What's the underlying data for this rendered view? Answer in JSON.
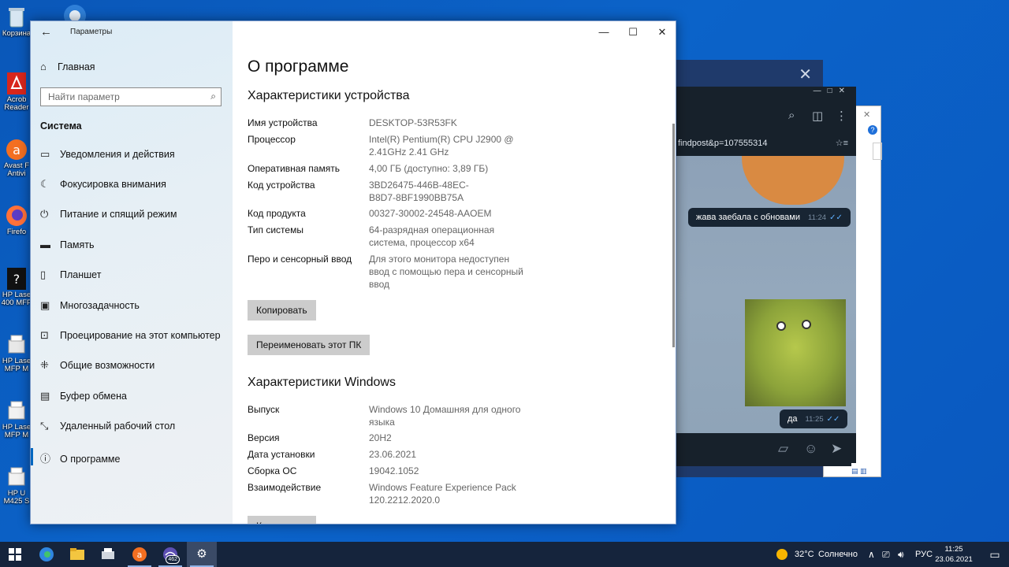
{
  "desktop": {
    "icons": [
      {
        "label": "Корзина",
        "icon": "recycle-bin-icon"
      },
      {
        "label": "Acrob",
        "label2": "Reader",
        "icon": "acrobat-icon"
      },
      {
        "label": "Avast F",
        "label2": "Antivi",
        "icon": "avast-icon"
      },
      {
        "label": "Firefo",
        "icon": "firefox-icon"
      },
      {
        "label": "HP Lase",
        "label2": "400 MFP",
        "icon": "hp-printer-icon"
      },
      {
        "label": "HP Lase",
        "label2": "MFP M",
        "icon": "hp-printer-icon"
      },
      {
        "label": "HP Lase",
        "label2": "MFP M",
        "icon": "hp-printer-icon"
      },
      {
        "label": "HP U",
        "label2": "M425 S",
        "icon": "hp-printer-icon"
      }
    ]
  },
  "telegram": {
    "pinned_text": "findpost&p=107555314",
    "messages": [
      {
        "text": "жава заебала с обновами",
        "time": "11:24",
        "ticks": "✓✓"
      },
      {
        "text": "да",
        "time": "11:25",
        "ticks": "✓✓"
      }
    ]
  },
  "settings": {
    "window_title": "Параметры",
    "home_label": "Главная",
    "search_placeholder": "Найти параметр",
    "section_label": "Система",
    "nav_items": [
      {
        "label": "Уведомления и действия",
        "icon": "notifications-icon"
      },
      {
        "label": "Фокусировка внимания",
        "icon": "focus-assist-icon"
      },
      {
        "label": "Питание и спящий режим",
        "icon": "power-icon"
      },
      {
        "label": "Память",
        "icon": "storage-icon"
      },
      {
        "label": "Планшет",
        "icon": "tablet-icon"
      },
      {
        "label": "Многозадачность",
        "icon": "multitasking-icon"
      },
      {
        "label": "Проецирование на этот компьютер",
        "icon": "projecting-icon"
      },
      {
        "label": "Общие возможности",
        "icon": "shared-experiences-icon"
      },
      {
        "label": "Буфер обмена",
        "icon": "clipboard-icon"
      },
      {
        "label": "Удаленный рабочий стол",
        "icon": "remote-desktop-icon"
      },
      {
        "label": "О программе",
        "icon": "info-icon",
        "active": true
      }
    ],
    "page_title": "О программе",
    "device_specs": {
      "heading": "Характеристики устройства",
      "rows": [
        {
          "key": "Имя устройства",
          "value": "DESKTOP-53R53FK"
        },
        {
          "key": "Процессор",
          "value": "Intel(R) Pentium(R) CPU  J2900  @ 2.41GHz   2.41 GHz"
        },
        {
          "key": "Оперативная память",
          "value": "4,00 ГБ (доступно: 3,89 ГБ)"
        },
        {
          "key": "Код устройства",
          "value": "3BD26475-446B-48EC-B8D7-8BF1990BB75A"
        },
        {
          "key": "Код продукта",
          "value": "00327-30002-24548-AAOEM"
        },
        {
          "key": "Тип системы",
          "value": "64-разрядная операционная система, процессор x64"
        },
        {
          "key": "Перо и сенсорный ввод",
          "value": "Для этого монитора недоступен ввод с помощью пера и сенсорный ввод"
        }
      ],
      "copy_button": "Копировать",
      "rename_button": "Переименовать этот ПК"
    },
    "windows_specs": {
      "heading": "Характеристики Windows",
      "rows": [
        {
          "key": "Выпуск",
          "value": "Windows 10 Домашняя для одного языка"
        },
        {
          "key": "Версия",
          "value": "20H2"
        },
        {
          "key": "Дата установки",
          "value": "23.06.2021"
        },
        {
          "key": "Сборка ОС",
          "value": "19042.1052"
        },
        {
          "key": "Взаимодействие",
          "value": "Windows Feature Experience Pack 120.2212.2020.0"
        }
      ],
      "copy_button": "Копировать"
    }
  },
  "taskbar": {
    "apps": [
      {
        "icon": "windows-start-icon"
      },
      {
        "icon": "edge-icon"
      },
      {
        "icon": "file-explorer-icon"
      },
      {
        "icon": "printer-app-icon"
      },
      {
        "icon": "avast-taskbar-icon"
      },
      {
        "icon": "telegram-taskbar-icon",
        "badge": "462"
      },
      {
        "icon": "settings-gear-icon",
        "active": true
      }
    ],
    "weather_temp": "32°C",
    "weather_text": "Солнечно",
    "language": "РУС",
    "time": "11:25",
    "date": "23.06.2021"
  },
  "colors": {
    "desktop": "#0b5fc2",
    "accent": "#0067c0",
    "taskbar": "#15243c",
    "telegram_bubble": "#182533"
  }
}
